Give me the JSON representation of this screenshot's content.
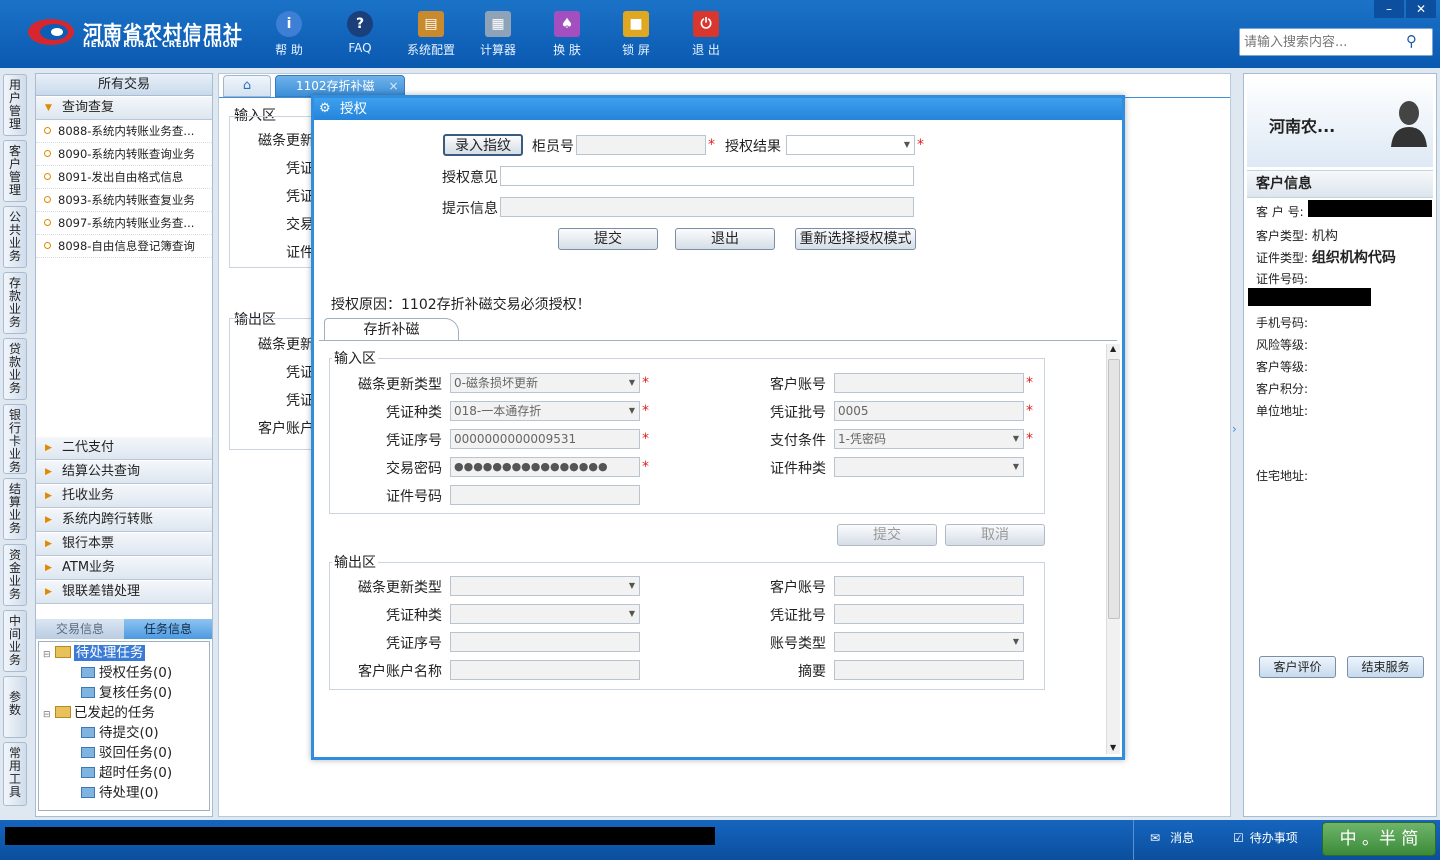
{
  "app": {
    "logo_cn": "河南省农村信用社",
    "logo_en": "HENAN RURAL CREDIT UNION",
    "brand_color": "#0b5db5",
    "accent_color": "#2f8ee0"
  },
  "toolbar": [
    {
      "label": "帮 助",
      "icon": "info-icon"
    },
    {
      "label": "FAQ",
      "icon": "question-icon"
    },
    {
      "label": "系统配置",
      "icon": "toolbox-icon"
    },
    {
      "label": "计算器",
      "icon": "calculator-icon"
    },
    {
      "label": "换 肤",
      "icon": "shirt-icon"
    },
    {
      "label": "锁 屏",
      "icon": "lock-icon"
    },
    {
      "label": "退 出",
      "icon": "power-icon"
    }
  ],
  "window": {
    "minimize": "–",
    "close": "✕"
  },
  "search": {
    "placeholder": "请输入搜索内容..."
  },
  "vtabs": [
    "用户管理",
    "客户管理",
    "公共业务",
    "存款业务",
    "贷款业务",
    "银行卡业务",
    "结算业务",
    "资金业务",
    "中间业务",
    "参数",
    "常用工具"
  ],
  "left_panel": {
    "header": "所有交易",
    "query_category": "查询查复",
    "query_items": [
      "8088-系统内转账业务查...",
      "8090-系统内转账查询业务",
      "8091-发出自由格式信息",
      "8093-系统内转账查复业务",
      "8097-系统内转账业务查...",
      "8098-自由信息登记簿查询"
    ],
    "categories": [
      "二代支付",
      "结算公共查询",
      "托收业务",
      "系统内跨行转账",
      "银行本票",
      "ATM业务",
      "银联差错处理"
    ],
    "task_tabs": [
      "交易信息",
      "任务信息"
    ],
    "tree": {
      "pending": "待处理任务",
      "pending_children": [
        "授权任务(0)",
        "复核任务(0)"
      ],
      "initiated": "已发起的任务",
      "initiated_children": [
        "待提交(0)",
        "驳回任务(0)",
        "超时任务(0)",
        "待处理(0)"
      ]
    }
  },
  "workspace": {
    "tab_label": "1102存折补磁",
    "tab_close": "×",
    "bg_input_title": "输入区",
    "bg_input_labels": [
      "磁条更新",
      "凭证",
      "凭证",
      "交易",
      "证件"
    ],
    "bg_output_title": "输出区",
    "bg_output_labels": [
      "磁条更新",
      "凭证",
      "凭证",
      "客户账户"
    ]
  },
  "modal": {
    "title": "授权",
    "fingerprint_btn": "录入指纹",
    "teller_label": "柜员号",
    "teller_value": "",
    "auth_result_label": "授权结果",
    "auth_result_value": "",
    "auth_opinion_label": "授权意见",
    "auth_opinion_value": "",
    "hint_label": "提示信息",
    "hint_value": "",
    "submit": "提交",
    "exit": "退出",
    "reselect": "重新选择授权模式",
    "reason": "授权原因：1102存折补磁交易必须授权！",
    "inner_tab": "存折补磁",
    "input_section": {
      "title": "输入区",
      "magstripe_type_label": "磁条更新类型",
      "magstripe_type_value": "0-磁条损坏更新",
      "cust_account_label": "客户账号",
      "cust_account_value": "",
      "voucher_type_label": "凭证种类",
      "voucher_type_value": "018-一本通存折",
      "voucher_batch_label": "凭证批号",
      "voucher_batch_value": "0005",
      "voucher_seq_label": "凭证序号",
      "voucher_seq_value": "0000000000009531",
      "pay_cond_label": "支付条件",
      "pay_cond_value": "1-凭密码",
      "trade_pwd_label": "交易密码",
      "trade_pwd_value": "●●●●●●●●●●●●●●●●",
      "id_type_label": "证件种类",
      "id_type_value": "",
      "id_no_label": "证件号码",
      "id_no_value": "",
      "submit": "提交",
      "cancel": "取消"
    },
    "output_section": {
      "title": "输出区",
      "magstripe_type_label": "磁条更新类型",
      "cust_account_label": "客户账号",
      "voucher_type_label": "凭证种类",
      "voucher_batch_label": "凭证批号",
      "voucher_seq_label": "凭证序号",
      "account_type_label": "账号类型",
      "account_name_label": "客户账户名称",
      "summary_label": "摘要"
    }
  },
  "customer": {
    "name": "河南农...",
    "info_title": "客户信息",
    "cust_no_label": "客 户 号:",
    "cust_type_label": "客户类型:",
    "cust_type_value": "机构",
    "id_type_label": "证件类型:",
    "id_type_value": "组织机构代码",
    "id_no_label": "证件号码:",
    "phone_label": "手机号码:",
    "risk_label": "风险等级:",
    "level_label": "客户等级:",
    "points_label": "客户积分:",
    "work_addr_label": "单位地址:",
    "home_addr_label": "住宅地址:",
    "rate_btn": "客户评价",
    "end_btn": "结束服务"
  },
  "statusbar": {
    "messages": "消息",
    "todo": "待办事项",
    "ime": "中 。半 简"
  }
}
